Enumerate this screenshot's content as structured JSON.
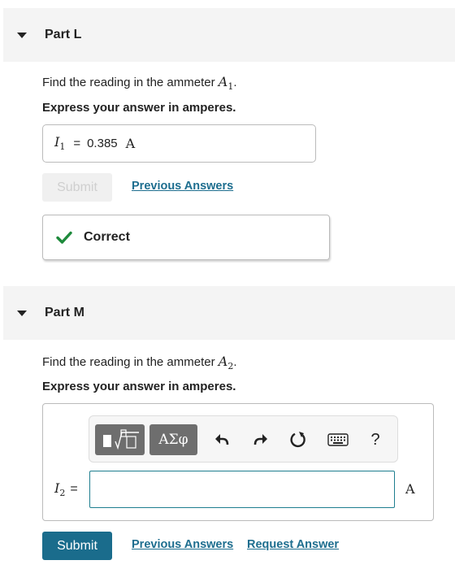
{
  "part_l": {
    "title": "Part L",
    "prompt_text": "Find the reading in the ammeter",
    "prompt_symbol": "A",
    "prompt_subscript": "1",
    "prompt_end": ".",
    "instruction": "Express your answer in amperes.",
    "answer_var": "I",
    "answer_sub": "1",
    "answer_eq": "=",
    "answer_value": "0.385",
    "answer_unit": "A",
    "submit_label": "Submit",
    "previous_answers_label": "Previous Answers",
    "feedback_label": "Correct"
  },
  "part_m": {
    "title": "Part M",
    "prompt_text": "Find the reading in the ammeter",
    "prompt_symbol": "A",
    "prompt_subscript": "2",
    "prompt_end": ".",
    "instruction": "Express your answer in amperes.",
    "answer_var": "I",
    "answer_sub": "2",
    "answer_eq": "=",
    "answer_value": "",
    "answer_unit": "A",
    "toolbar": {
      "greek_label": "ΑΣφ",
      "help_label": "?",
      "icons": [
        "templates-icon",
        "greek-symbols-icon",
        "undo-icon",
        "redo-icon",
        "reset-icon",
        "keyboard-icon",
        "help-icon"
      ]
    },
    "submit_label": "Submit",
    "previous_answers_label": "Previous Answers",
    "request_answer_label": "Request Answer"
  },
  "colors": {
    "header_bg": "#f4f4f4",
    "link": "#1e6e8f",
    "submit_bg": "#1a6c8c",
    "correct_check": "#1e8a3c",
    "toolbar_btn": "#6e6e6e"
  }
}
